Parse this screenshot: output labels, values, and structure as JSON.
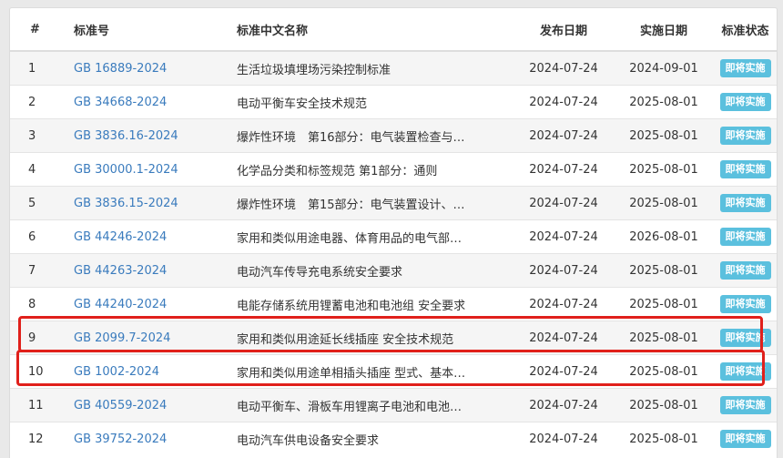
{
  "table": {
    "headers": {
      "num": "#",
      "code": "标准号",
      "name": "标准中文名称",
      "publish": "发布日期",
      "implement": "实施日期",
      "status": "标准状态"
    },
    "rows": [
      {
        "num": "1",
        "code": "GB 16889-2024",
        "name": "生活垃圾填埋场污染控制标准",
        "publish": "2024-07-24",
        "implement": "2024-09-01",
        "status": "即将实施"
      },
      {
        "num": "2",
        "code": "GB 34668-2024",
        "name": "电动平衡车安全技术规范",
        "publish": "2024-07-24",
        "implement": "2025-08-01",
        "status": "即将实施"
      },
      {
        "num": "3",
        "code": "GB 3836.16-2024",
        "name": "爆炸性环境　第16部分：电气装置检查与…",
        "publish": "2024-07-24",
        "implement": "2025-08-01",
        "status": "即将实施"
      },
      {
        "num": "4",
        "code": "GB 30000.1-2024",
        "name": "化学品分类和标签规范 第1部分：通则",
        "publish": "2024-07-24",
        "implement": "2025-08-01",
        "status": "即将实施"
      },
      {
        "num": "5",
        "code": "GB 3836.15-2024",
        "name": "爆炸性环境　第15部分：电气装置设计、…",
        "publish": "2024-07-24",
        "implement": "2025-08-01",
        "status": "即将实施"
      },
      {
        "num": "6",
        "code": "GB 44246-2024",
        "name": "家用和类似用途电器、体育用品的电气部…",
        "publish": "2024-07-24",
        "implement": "2026-08-01",
        "status": "即将实施"
      },
      {
        "num": "7",
        "code": "GB 44263-2024",
        "name": "电动汽车传导充电系统安全要求",
        "publish": "2024-07-24",
        "implement": "2025-08-01",
        "status": "即将实施"
      },
      {
        "num": "8",
        "code": "GB 44240-2024",
        "name": "电能存储系统用锂蓄电池和电池组 安全要求",
        "publish": "2024-07-24",
        "implement": "2025-08-01",
        "status": "即将实施"
      },
      {
        "num": "9",
        "code": "GB 2099.7-2024",
        "name": "家用和类似用途延长线插座 安全技术规范",
        "publish": "2024-07-24",
        "implement": "2025-08-01",
        "status": "即将实施"
      },
      {
        "num": "10",
        "code": "GB 1002-2024",
        "name": "家用和类似用途单相插头插座 型式、基本…",
        "publish": "2024-07-24",
        "implement": "2025-08-01",
        "status": "即将实施"
      },
      {
        "num": "11",
        "code": "GB 40559-2024",
        "name": "电动平衡车、滑板车用锂离子电池和电池…",
        "publish": "2024-07-24",
        "implement": "2025-08-01",
        "status": "即将实施"
      },
      {
        "num": "12",
        "code": "GB 39752-2024",
        "name": "电动汽车供电设备安全要求",
        "publish": "2024-07-24",
        "implement": "2025-08-01",
        "status": "即将实施"
      }
    ]
  },
  "colors": {
    "link": "#3a7bbd",
    "badge": "#5bc0de",
    "highlight": "#e0201b",
    "stripe": "#f5f5f5"
  }
}
